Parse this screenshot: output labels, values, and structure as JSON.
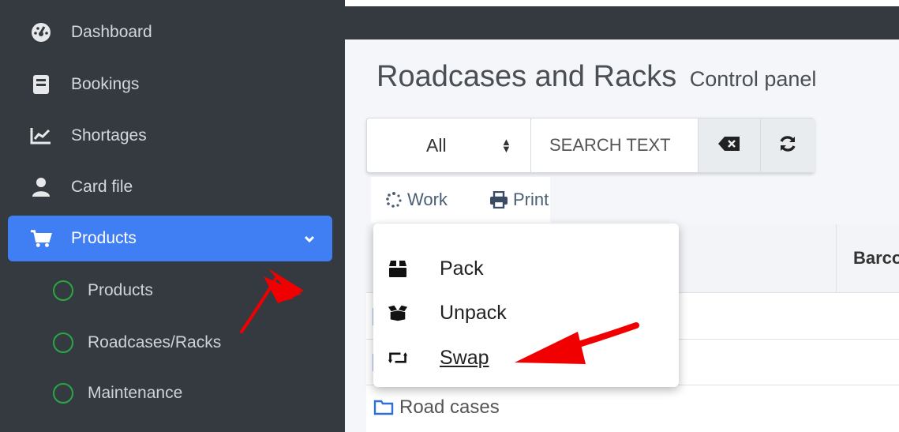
{
  "sidebar": {
    "items": [
      {
        "label": "Dashboard",
        "icon": "gauge-icon"
      },
      {
        "label": "Bookings",
        "icon": "book-icon"
      },
      {
        "label": "Shortages",
        "icon": "chart-line-icon"
      },
      {
        "label": "Card file",
        "icon": "user-icon"
      },
      {
        "label": "Products",
        "icon": "cart-icon",
        "active": true
      }
    ],
    "subitems": [
      {
        "label": "Products"
      },
      {
        "label": "Roadcases/Racks"
      },
      {
        "label": "Maintenance"
      }
    ]
  },
  "header": {
    "title": "Roadcases and Racks",
    "subtitle": "Control panel"
  },
  "search": {
    "filter_value": "All",
    "placeholder": "SEARCH TEXT"
  },
  "toolbar": {
    "work_label": "Work",
    "print_label": "Print"
  },
  "table": {
    "columns": [
      "Barcode"
    ],
    "rows": [
      {
        "label": "Road cases"
      }
    ]
  },
  "dropdown": {
    "items": [
      {
        "label": "Pack",
        "icon": "box-icon"
      },
      {
        "label": "Unpack",
        "icon": "box-open-icon"
      },
      {
        "label": "Swap",
        "icon": "retweet-icon"
      }
    ]
  },
  "colors": {
    "sidebar_bg": "#343a40",
    "active_bg": "#3f7ef3",
    "circle_green": "#28a745",
    "annotation_red": "#f00000"
  }
}
